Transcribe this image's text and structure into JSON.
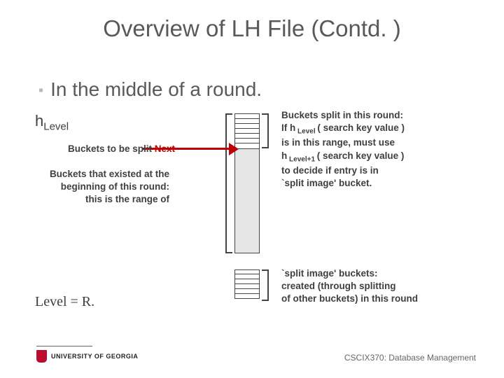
{
  "title": "Overview of LH File (Contd. )",
  "bullet": "In the middle of a round.",
  "left": {
    "next_prefix": "Buckets to be split ",
    "next_word": "Next",
    "existed": "Buckets that existed at the\nbeginning of this round:\nthis is the range of",
    "hlevel_base": "h",
    "hlevel_sub": "Level",
    "level_eq": "Level = R."
  },
  "right": {
    "round_l1": "Buckets split in this round:",
    "round_l2a": "If h",
    "round_l2sub": " Level ",
    "round_l2b": " ( search key value )",
    "round_l3": "is in this range, must use",
    "round_l4a": "h",
    "round_l4sub": " Level+1 ",
    "round_l4b": "( search key value )",
    "round_l5": "to decide if entry is in",
    "round_l6": "`split image' bucket.",
    "split_l1": "`split image' buckets:",
    "split_l2": "created (through splitting",
    "split_l3": "of other buckets) in this round"
  },
  "footer": {
    "univ": "UNIVERSITY OF GEORGIA",
    "course": "CSCIX370: Database Management"
  }
}
